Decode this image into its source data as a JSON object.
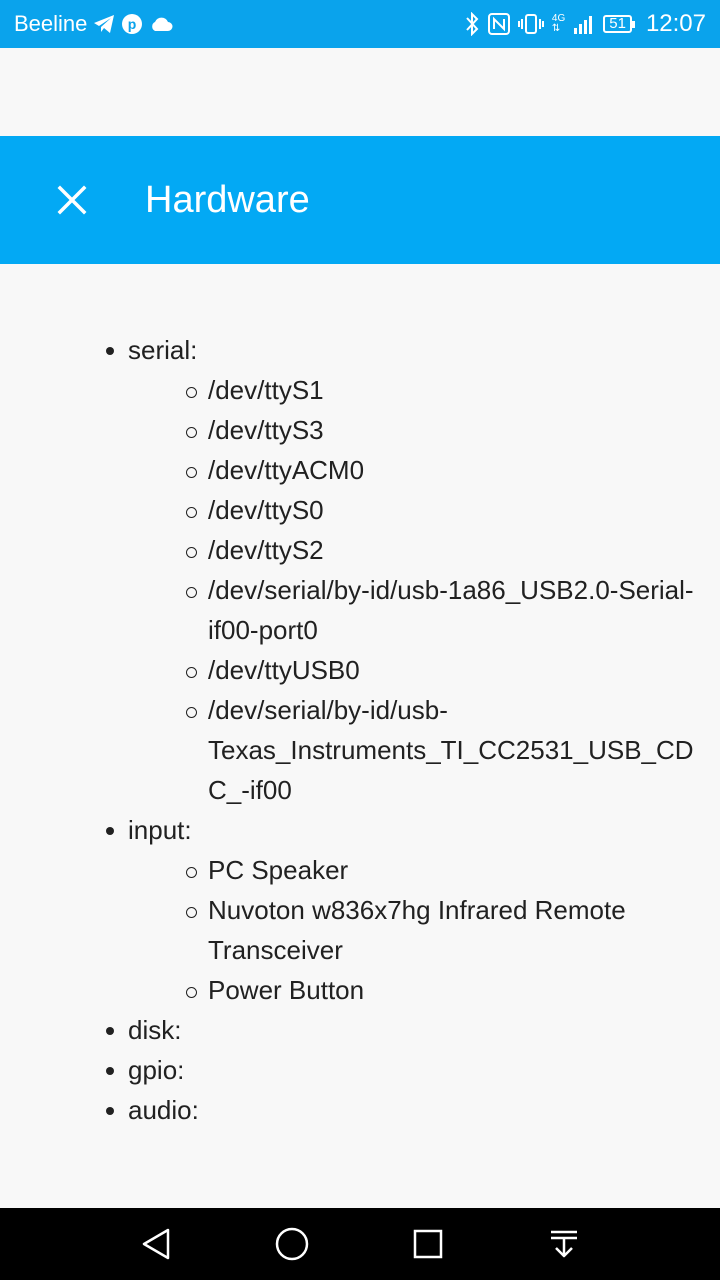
{
  "status_bar": {
    "carrier": "Beeline",
    "network_type": "4G",
    "battery": "51",
    "time": "12:07",
    "icons": [
      "telegram-icon",
      "pinterest-icon",
      "cloud-icon",
      "bluetooth-icon",
      "nfc-icon",
      "vibrate-icon",
      "signal-icon",
      "battery-icon"
    ]
  },
  "header": {
    "title": "Hardware",
    "close_icon": "close-icon",
    "background": "#03a9f4"
  },
  "hardware": {
    "serial": {
      "label": "serial:",
      "items": [
        "/dev/ttyS1",
        "/dev/ttyS3",
        "/dev/ttyACM0",
        "/dev/ttyS0",
        "/dev/ttyS2",
        "/dev/serial/by-id/usb-1a86_USB2.0-Serial-if00-port0",
        "/dev/ttyUSB0",
        "/dev/serial/by-id/usb-Texas_Instruments_TI_CC2531_USB_CDC_-if00"
      ]
    },
    "input": {
      "label": "input:",
      "items": [
        "PC Speaker",
        "Nuvoton w836x7hg Infrared Remote Transceiver",
        "Power Button"
      ]
    },
    "disk": {
      "label": "disk:"
    },
    "gpio": {
      "label": "gpio:"
    },
    "audio": {
      "label": "audio:"
    }
  },
  "nav_bar": {
    "icons": [
      "back-icon",
      "home-icon",
      "recents-icon",
      "notification-pull-icon"
    ]
  }
}
